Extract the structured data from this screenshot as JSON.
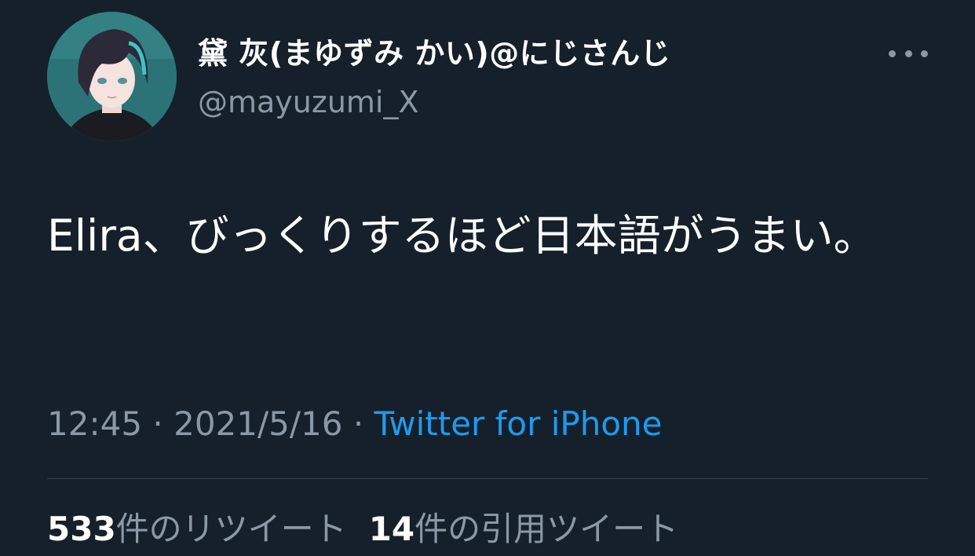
{
  "tweet": {
    "author": {
      "display_name": "黛 灰(まゆずみ かい)@にじさんじ",
      "handle": "@mayuzumi_X",
      "avatar_icon": "avatar-image"
    },
    "more_icon": "ellipsis-icon",
    "text": "Elira、びっくりするほど日本語がうまい。",
    "time": "12:45",
    "date": "2021/5/16",
    "separator": "·",
    "source": "Twitter for iPhone"
  },
  "stats": {
    "retweets_count": "533",
    "retweets_label": "件のリツイート",
    "quotes_count": "14",
    "quotes_label": "件の引用ツイート"
  },
  "colors": {
    "background": "#15202b",
    "primary_text": "#ffffff",
    "secondary_text": "#8b98a5",
    "link": "#1d9bf0",
    "divider": "#38444d"
  }
}
